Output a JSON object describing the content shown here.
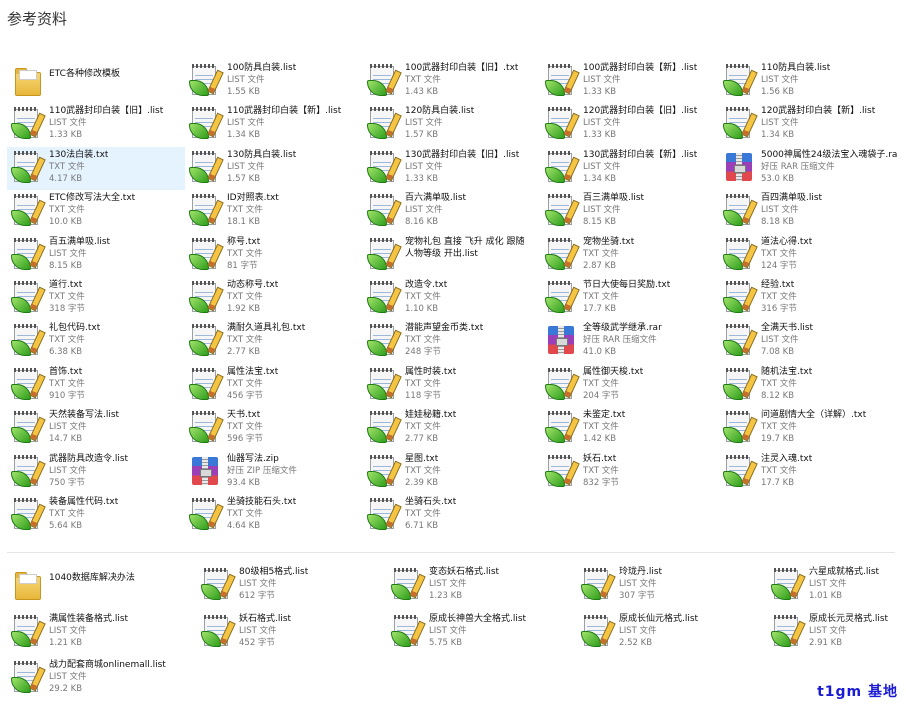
{
  "header": {
    "title": "参考资料"
  },
  "group1": [
    {
      "name": "ETC各种修改模板",
      "type": "",
      "size": "",
      "icon": "folder-icon"
    },
    {
      "name": "100防具白装.list",
      "type": "LIST 文件",
      "size": "1.55 KB",
      "icon": "notepad-icon"
    },
    {
      "name": "100武器封印白装【旧】.txt",
      "type": "TXT 文件",
      "size": "1.43 KB",
      "icon": "notepad-icon"
    },
    {
      "name": "100武器封印白装【新】.list",
      "type": "LIST 文件",
      "size": "1.33 KB",
      "icon": "notepad-icon"
    },
    {
      "name": "110防具白装.list",
      "type": "LIST 文件",
      "size": "1.56 KB",
      "icon": "notepad-icon"
    },
    {
      "name": "110武器封印白装【旧】.list",
      "type": "LIST 文件",
      "size": "1.33 KB",
      "icon": "notepad-icon"
    },
    {
      "name": "110武器封印白装【新】.list",
      "type": "LIST 文件",
      "size": "1.34 KB",
      "icon": "notepad-icon"
    },
    {
      "name": "120防具白装.list",
      "type": "LIST 文件",
      "size": "1.57 KB",
      "icon": "notepad-icon"
    },
    {
      "name": "120武器封印白装【旧】.list",
      "type": "LIST 文件",
      "size": "1.33 KB",
      "icon": "notepad-icon"
    },
    {
      "name": "120武器封印白装【新】.list",
      "type": "LIST 文件",
      "size": "1.34 KB",
      "icon": "notepad-icon"
    },
    {
      "name": "130法白装.txt",
      "type": "TXT 文件",
      "size": "4.17 KB",
      "icon": "notepad-icon",
      "selected": true
    },
    {
      "name": "130防具白装.list",
      "type": "LIST 文件",
      "size": "1.57 KB",
      "icon": "notepad-icon"
    },
    {
      "name": "130武器封印白装【旧】.list",
      "type": "LIST 文件",
      "size": "1.33 KB",
      "icon": "notepad-icon"
    },
    {
      "name": "130武器封印白装【新】.list",
      "type": "LIST 文件",
      "size": "1.34 KB",
      "icon": "notepad-icon"
    },
    {
      "name": "5000神属性24级法宝入魂袋子.rar",
      "type": "好压 RAR 压缩文件",
      "size": "53.0 KB",
      "icon": "archive-icon"
    },
    {
      "name": "ETC修改写法大全.txt",
      "type": "TXT 文件",
      "size": "10.0 KB",
      "icon": "notepad-icon"
    },
    {
      "name": "ID对照表.txt",
      "type": "TXT 文件",
      "size": "18.1 KB",
      "icon": "notepad-icon"
    },
    {
      "name": "百六满单吸.list",
      "type": "LIST 文件",
      "size": "8.16 KB",
      "icon": "notepad-icon"
    },
    {
      "name": "百三满单吸.list",
      "type": "LIST 文件",
      "size": "8.15 KB",
      "icon": "notepad-icon"
    },
    {
      "name": "百四满单吸.list",
      "type": "LIST 文件",
      "size": "8.18 KB",
      "icon": "notepad-icon"
    },
    {
      "name": "百五满单吸.list",
      "type": "LIST 文件",
      "size": "8.15 KB",
      "icon": "notepad-icon"
    },
    {
      "name": "称号.txt",
      "type": "TXT 文件",
      "size": "81 字节",
      "icon": "notepad-icon"
    },
    {
      "name": "宠物礼包 直接 飞升 成化 跟随人物等级 开出.list",
      "type": "",
      "size": "",
      "icon": "notepad-icon",
      "wrap": true
    },
    {
      "name": "宠物坐骑.txt",
      "type": "TXT 文件",
      "size": "2.87 KB",
      "icon": "notepad-icon"
    },
    {
      "name": "道法心得.txt",
      "type": "TXT 文件",
      "size": "124 字节",
      "icon": "notepad-icon"
    },
    {
      "name": "道行.txt",
      "type": "TXT 文件",
      "size": "318 字节",
      "icon": "notepad-icon"
    },
    {
      "name": "动态称号.txt",
      "type": "TXT 文件",
      "size": "1.92 KB",
      "icon": "notepad-icon"
    },
    {
      "name": "改造令.txt",
      "type": "TXT 文件",
      "size": "1.10 KB",
      "icon": "notepad-icon"
    },
    {
      "name": "节日大使每日奖励.txt",
      "type": "TXT 文件",
      "size": "17.7 KB",
      "icon": "notepad-icon"
    },
    {
      "name": "经验.txt",
      "type": "TXT 文件",
      "size": "316 字节",
      "icon": "notepad-icon"
    },
    {
      "name": "礼包代码.txt",
      "type": "TXT 文件",
      "size": "6.38 KB",
      "icon": "notepad-icon"
    },
    {
      "name": "满耐久道具礼包.txt",
      "type": "TXT 文件",
      "size": "2.77 KB",
      "icon": "notepad-icon"
    },
    {
      "name": "潜能声望金币类.txt",
      "type": "TXT 文件",
      "size": "248 字节",
      "icon": "notepad-icon"
    },
    {
      "name": "全等级武学继承.rar",
      "type": "好压 RAR 压缩文件",
      "size": "41.0 KB",
      "icon": "archive-icon"
    },
    {
      "name": "全满天书.list",
      "type": "LIST 文件",
      "size": "7.08 KB",
      "icon": "notepad-icon"
    },
    {
      "name": "首饰.txt",
      "type": "TXT 文件",
      "size": "910 字节",
      "icon": "notepad-icon"
    },
    {
      "name": "属性法宝.txt",
      "type": "TXT 文件",
      "size": "456 字节",
      "icon": "notepad-icon"
    },
    {
      "name": "属性时装.txt",
      "type": "TXT 文件",
      "size": "118 字节",
      "icon": "notepad-icon"
    },
    {
      "name": "属性御天梭.txt",
      "type": "TXT 文件",
      "size": "204 字节",
      "icon": "notepad-icon"
    },
    {
      "name": "随机法宝.txt",
      "type": "TXT 文件",
      "size": "8.12 KB",
      "icon": "notepad-icon"
    },
    {
      "name": "天然装备写法.list",
      "type": "LIST 文件",
      "size": "14.7 KB",
      "icon": "notepad-icon"
    },
    {
      "name": "天书.txt",
      "type": "TXT 文件",
      "size": "596 字节",
      "icon": "notepad-icon"
    },
    {
      "name": "娃娃秘籍.txt",
      "type": "TXT 文件",
      "size": "2.77 KB",
      "icon": "notepad-icon"
    },
    {
      "name": "未鉴定.txt",
      "type": "TXT 文件",
      "size": "1.42 KB",
      "icon": "notepad-icon"
    },
    {
      "name": "问道剧情大全（详解）.txt",
      "type": "TXT 文件",
      "size": "19.7 KB",
      "icon": "notepad-icon"
    },
    {
      "name": "武器防具改造令.list",
      "type": "LIST 文件",
      "size": "750 字节",
      "icon": "notepad-icon"
    },
    {
      "name": "仙器写法.zip",
      "type": "好压 ZIP 压缩文件",
      "size": "93.4 KB",
      "icon": "archive-icon"
    },
    {
      "name": "星图.txt",
      "type": "TXT 文件",
      "size": "2.39 KB",
      "icon": "notepad-icon"
    },
    {
      "name": "妖石.txt",
      "type": "TXT 文件",
      "size": "832 字节",
      "icon": "notepad-icon"
    },
    {
      "name": "注灵入魂.txt",
      "type": "TXT 文件",
      "size": "17.7 KB",
      "icon": "notepad-icon"
    },
    {
      "name": "装备属性代码.txt",
      "type": "TXT 文件",
      "size": "5.64 KB",
      "icon": "notepad-icon"
    },
    {
      "name": "坐骑技能石头.txt",
      "type": "TXT 文件",
      "size": "4.64 KB",
      "icon": "notepad-icon"
    },
    {
      "name": "坐骑石头.txt",
      "type": "TXT 文件",
      "size": "6.71 KB",
      "icon": "notepad-icon"
    }
  ],
  "group2": [
    {
      "name": "1040数据库解决办法",
      "type": "",
      "size": "",
      "icon": "folder-icon"
    },
    {
      "name": "80级相5格式.list",
      "type": "LIST 文件",
      "size": "612 字节",
      "icon": "notepad-icon"
    },
    {
      "name": "变态妖石格式.list",
      "type": "LIST 文件",
      "size": "1.23 KB",
      "icon": "notepad-icon"
    },
    {
      "name": "玲珑丹.list",
      "type": "LIST 文件",
      "size": "307 字节",
      "icon": "notepad-icon"
    },
    {
      "name": "六星成就格式.list",
      "type": "LIST 文件",
      "size": "1.01 KB",
      "icon": "notepad-icon"
    },
    {
      "name": "满属性装备格式.list",
      "type": "LIST 文件",
      "size": "1.21 KB",
      "icon": "notepad-icon"
    },
    {
      "name": "妖石格式.list",
      "type": "LIST 文件",
      "size": "452 字节",
      "icon": "notepad-icon"
    },
    {
      "name": "原成长神兽大全格式.list",
      "type": "LIST 文件",
      "size": "5.75 KB",
      "icon": "notepad-icon"
    },
    {
      "name": "原成长仙元格式.list",
      "type": "LIST 文件",
      "size": "2.52 KB",
      "icon": "notepad-icon"
    },
    {
      "name": "原成长元灵格式.list",
      "type": "LIST 文件",
      "size": "2.91 KB",
      "icon": "notepad-icon"
    },
    {
      "name": "战力配套商城onlinemall.list",
      "type": "LIST 文件",
      "size": "29.2 KB",
      "icon": "notepad-icon"
    }
  ],
  "watermark": "t1gm 基地",
  "colors": {
    "selection": "#e5f3ff",
    "watermark": "#1b1bd6"
  }
}
